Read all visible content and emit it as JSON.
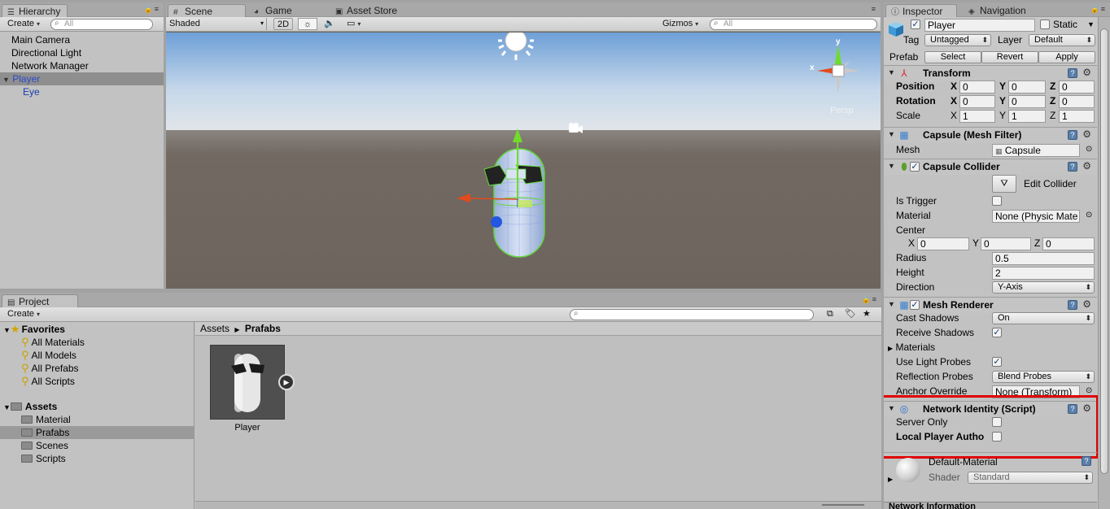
{
  "hierarchy": {
    "tab": "Hierarchy",
    "create": "Create",
    "search_placeholder": "All",
    "items": [
      "Main Camera",
      "Directional Light",
      "Network Manager",
      "Player"
    ],
    "child": "Eye"
  },
  "scene": {
    "tabs": [
      "Scene",
      "Game",
      "Asset Store"
    ],
    "shading": "Shaded",
    "mode2d": "2D",
    "gizmos": "Gizmos",
    "search_placeholder": "All",
    "persp": "Persp",
    "axis_x": "x",
    "axis_y": "y",
    "colors": {
      "sky_top": "#6d9fd7",
      "horizon": "#e4e7ea",
      "ground": "#6e645e"
    }
  },
  "project": {
    "tab": "Project",
    "create": "Create",
    "favorites_label": "Favorites",
    "favorites": [
      "All Materials",
      "All Models",
      "All Prefabs",
      "All Scripts"
    ],
    "assets_label": "Assets",
    "folders": [
      "Material",
      "Prafabs",
      "Scenes",
      "Scripts"
    ],
    "breadcrumb": [
      "Assets",
      "Prafabs"
    ],
    "asset_name": "Player"
  },
  "inspector": {
    "tabs": [
      "Inspector",
      "Navigation"
    ],
    "object_name": "Player",
    "static_label": "Static",
    "tag_label": "Tag",
    "tag_value": "Untagged",
    "layer_label": "Layer",
    "layer_value": "Default",
    "prefab_label": "Prefab",
    "prefab_buttons": [
      "Select",
      "Revert",
      "Apply"
    ],
    "transform": {
      "title": "Transform",
      "rows": [
        {
          "label": "Position",
          "x": "0",
          "y": "0",
          "z": "0"
        },
        {
          "label": "Rotation",
          "x": "0",
          "y": "0",
          "z": "0"
        },
        {
          "label": "Scale",
          "x": "1",
          "y": "1",
          "z": "1"
        }
      ]
    },
    "mesh_filter": {
      "title": "Capsule (Mesh Filter)",
      "mesh_label": "Mesh",
      "mesh_value": "Capsule"
    },
    "capsule_collider": {
      "title": "Capsule Collider",
      "edit_button": "Edit Collider",
      "is_trigger": "Is Trigger",
      "material_label": "Material",
      "material_value": "None (Physic Mate",
      "center_label": "Center",
      "center": {
        "x": "0",
        "y": "0",
        "z": "0"
      },
      "radius_label": "Radius",
      "radius_value": "0.5",
      "height_label": "Height",
      "height_value": "2",
      "direction_label": "Direction",
      "direction_value": "Y-Axis"
    },
    "mesh_renderer": {
      "title": "Mesh Renderer",
      "cast_shadows_label": "Cast Shadows",
      "cast_shadows_value": "On",
      "receive_shadows_label": "Receive Shadows",
      "materials_label": "Materials",
      "light_probes_label": "Use Light Probes",
      "reflection_label": "Reflection Probes",
      "reflection_value": "Blend Probes",
      "anchor_label": "Anchor Override",
      "anchor_value": "None (Transform)"
    },
    "network_identity": {
      "title": "Network Identity (Script)",
      "server_only": "Server Only",
      "local_player": "Local Player Autho"
    },
    "material": {
      "name": "Default-Material",
      "shader_label": "Shader",
      "shader_value": "Standard"
    },
    "bottom_label": "Network Information",
    "highlight_color": "#e00000"
  }
}
